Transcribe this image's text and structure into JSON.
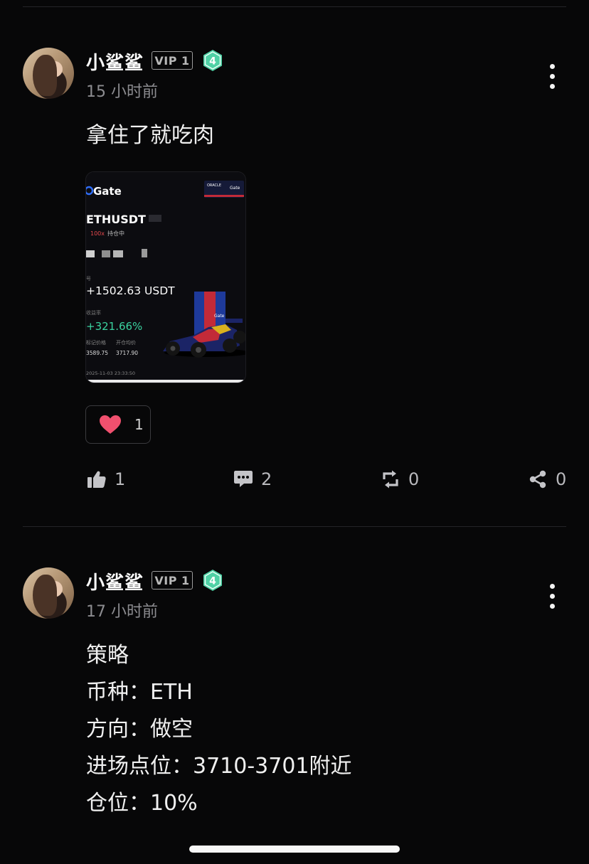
{
  "posts": [
    {
      "username": "小鲨鲨",
      "vip_label": "VIP 1",
      "level": "4",
      "time": "15 小时前",
      "text": "拿住了就吃肉",
      "image": {
        "brand": "Gate",
        "pair": "ETHUSDT",
        "leverage": "100x",
        "status": "持仓中",
        "pnl": "+1502.63 USDT",
        "roi_label": "收益率",
        "roi": "+321.66%",
        "mark_label": "标记价格",
        "mark_value": "3589.75",
        "open_label": "开仓均价",
        "open_value": "3717.90",
        "timestamp": "2025-11-03 23:33:50"
      },
      "reaction_count": "1",
      "actions": {
        "likes": "1",
        "comments": "2",
        "reposts": "0",
        "shares": "0"
      }
    },
    {
      "username": "小鲨鲨",
      "vip_label": "VIP 1",
      "level": "4",
      "time": "17 小时前",
      "lines": [
        "策略",
        "币种：ETH",
        "方向：做空",
        "进场点位：3710-3701附近",
        "仓位：10%"
      ]
    }
  ],
  "colors": {
    "background": "#070708",
    "level_badge": "#4fd1a5",
    "heart": "#f0506e",
    "roi_green": "#3ad29f",
    "leverage_red": "#e5484d"
  }
}
